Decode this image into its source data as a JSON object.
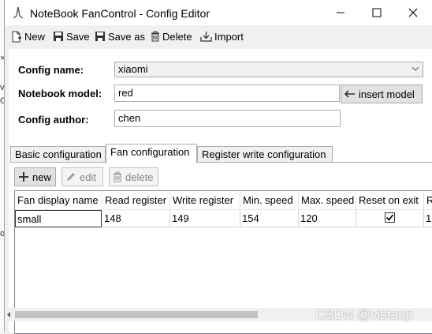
{
  "window": {
    "title": "NoteBook FanControl - Config Editor"
  },
  "toolbar": {
    "new_label": "New",
    "save_label": "Save",
    "save_as_label": "Save as",
    "delete_label": "Delete",
    "import_label": "Import"
  },
  "form": {
    "config_name_label": "Config name:",
    "config_name_value": "xiaomi",
    "notebook_model_label": "Notebook model:",
    "notebook_model_value": "red",
    "insert_model_label": "insert model",
    "config_author_label": "Config author:",
    "config_author_value": "chen"
  },
  "tabs": [
    {
      "label": "Basic configuration"
    },
    {
      "label": "Fan configuration"
    },
    {
      "label": "Register write configuration"
    }
  ],
  "fan_tab": {
    "new_label": "new",
    "edit_label": "edit",
    "delete_label": "delete",
    "columns": [
      "Fan display name",
      "Read register",
      "Write register",
      "Min. speed",
      "Max. speed",
      "Reset on exit",
      "R"
    ],
    "rows": [
      {
        "name": "small",
        "read": "148",
        "write": "149",
        "min": "154",
        "max": "120",
        "reset": true
      }
    ]
  },
  "watermark": "CSDN @vistaup",
  "colors": {
    "window_bg": "#f0f0f0",
    "disabled_text": "#838383",
    "scroll_thumb": "#c2c2c2"
  }
}
